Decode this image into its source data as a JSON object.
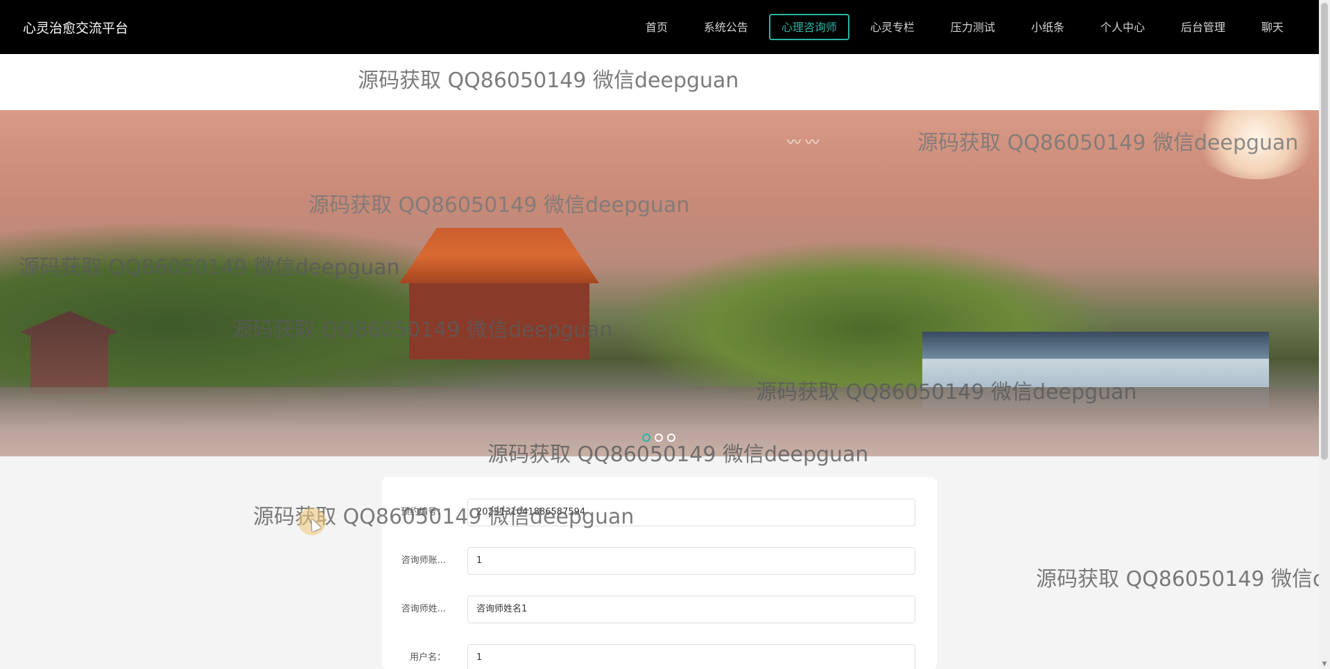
{
  "header": {
    "brand": "心灵治愈交流平台",
    "nav": [
      {
        "label": "首页",
        "active": false
      },
      {
        "label": "系统公告",
        "active": false
      },
      {
        "label": "心理咨询师",
        "active": true
      },
      {
        "label": "心灵专栏",
        "active": false
      },
      {
        "label": "压力测试",
        "active": false
      },
      {
        "label": "小纸条",
        "active": false
      },
      {
        "label": "个人中心",
        "active": false
      },
      {
        "label": "后台管理",
        "active": false
      },
      {
        "label": "聊天",
        "active": false
      }
    ],
    "active_color": "#2ab5a6"
  },
  "carousel": {
    "slide_count": 3,
    "active_index": 0,
    "birds": "〰 〰"
  },
  "form": {
    "fields": [
      {
        "label": "预约编号：",
        "value": "2023131041886587594"
      },
      {
        "label": "咨询师账...",
        "value": "1"
      },
      {
        "label": "咨询师姓...",
        "value": "咨询师姓名1"
      },
      {
        "label": "用户名：",
        "value": "1"
      }
    ]
  },
  "watermark": "源码获取 QQ86050149 微信deepguan",
  "watermark_cut": "源码获取 QQ86050149 微信de"
}
